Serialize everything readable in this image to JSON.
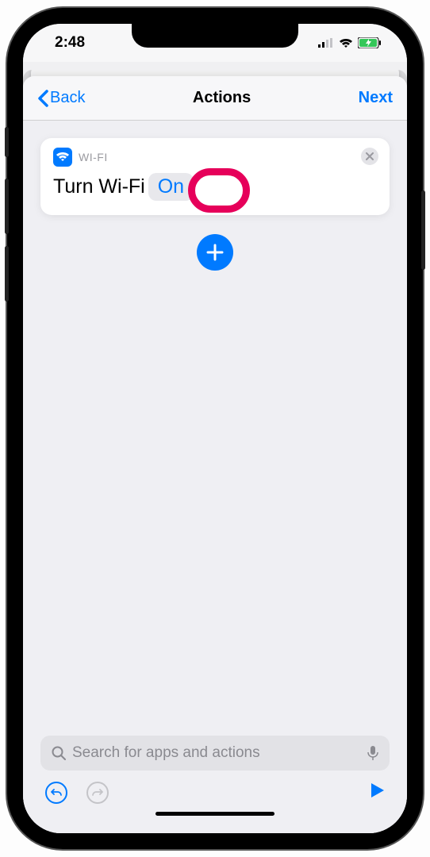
{
  "status": {
    "time": "2:48"
  },
  "nav": {
    "back": "Back",
    "title": "Actions",
    "next": "Next"
  },
  "action_card": {
    "category": "WI-FI",
    "prefix": "Turn Wi-Fi",
    "param": "On"
  },
  "search": {
    "placeholder": "Search for apps and actions"
  }
}
